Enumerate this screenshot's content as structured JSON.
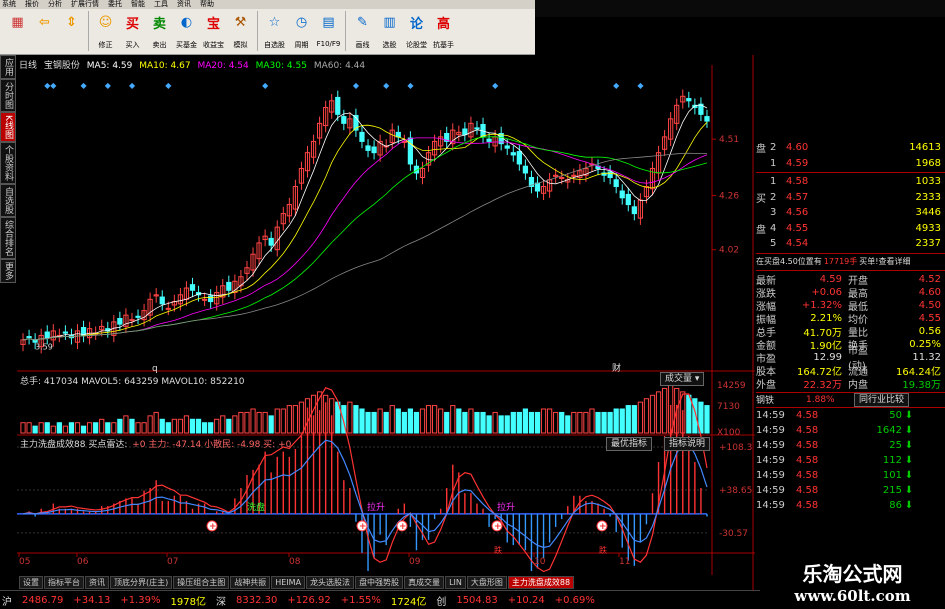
{
  "menu": [
    "系统",
    "报价",
    "分析",
    "扩展行情",
    "委托",
    "智能",
    "工具",
    "资讯",
    "帮助"
  ],
  "toolbar": [
    {
      "label": "",
      "icon": "grid-icon",
      "glyph": "▦",
      "color": "#c33"
    },
    {
      "label": "",
      "icon": "back-arrow-icon",
      "glyph": "⇦",
      "color": "#e90"
    },
    {
      "label": "",
      "icon": "up-down-icon",
      "glyph": "⇕",
      "color": "#e90"
    },
    {
      "label": "修正",
      "icon": "fix-icon",
      "glyph": "☺",
      "color": "#e90"
    },
    {
      "label": "买入",
      "icon": "buy-icon",
      "glyph": "买",
      "color": "#d00"
    },
    {
      "label": "卖出",
      "icon": "sell-icon",
      "glyph": "卖",
      "color": "#080"
    },
    {
      "label": "买基金",
      "icon": "fund-icon",
      "glyph": "◐",
      "color": "#06c"
    },
    {
      "label": "收益宝",
      "icon": "bao-icon",
      "glyph": "宝",
      "color": "#d00"
    },
    {
      "label": "模拟",
      "icon": "hammer-icon",
      "glyph": "⚒",
      "color": "#a50"
    },
    {
      "label": "自选股",
      "icon": "star-list-icon",
      "glyph": "☆",
      "color": "#06c"
    },
    {
      "label": "周期",
      "icon": "clock-icon",
      "glyph": "◷",
      "color": "#06c"
    },
    {
      "label": "F10/F9",
      "icon": "f10-icon",
      "glyph": "▤",
      "color": "#06c"
    },
    {
      "label": "画线",
      "icon": "pencil-icon",
      "glyph": "✎",
      "color": "#06c"
    },
    {
      "label": "选股",
      "icon": "select-stock-icon",
      "glyph": "▥",
      "color": "#06c"
    },
    {
      "label": "论股堂",
      "icon": "forum-icon",
      "glyph": "论",
      "color": "#06c"
    },
    {
      "label": "抗基手",
      "icon": "gao-icon",
      "glyph": "高",
      "color": "#d00"
    }
  ],
  "left_tabs": [
    {
      "label": "应用",
      "active": false
    },
    {
      "label": "分时图",
      "active": false
    },
    {
      "label": "K线图",
      "active": true
    },
    {
      "label": "个股资料",
      "active": false
    },
    {
      "label": "自选股",
      "active": false
    },
    {
      "label": "综合排名",
      "active": false
    },
    {
      "label": "更多",
      "active": false
    }
  ],
  "info": {
    "period": "日线",
    "stock": "宝钢股份",
    "ma5": "MA5: 4.59",
    "ma10": "MA10: 4.67",
    "ma20": "MA20: 4.54",
    "ma30": "MA30: 4.55",
    "ma60": "MA60: 4.44"
  },
  "price_axis": [
    "4.51",
    "4.26",
    "4.02"
  ],
  "price_low_label": "3.59",
  "marker_q": "q",
  "marker_cai": "财",
  "volume": {
    "line": "总手: 417034  MAVOL5: 643259  MAVOL10: 852210",
    "dropdown": "成交量",
    "axis": [
      "14259",
      "7130",
      "X100"
    ]
  },
  "indicator": {
    "line_a": "主力洗盘成效88  买点雷达:",
    "line_b": "+0  主力: -47.14  小散民: -4.98  买: +0",
    "btn_best": "最优指标",
    "btn_desc": "指标说明",
    "axis": [
      "+108.3",
      "+38.65",
      "-30.57"
    ],
    "tags": [
      "洗盘",
      "拉升",
      "拉升"
    ],
    "buy_glyph": "+",
    "dip_glyph": "跌"
  },
  "date_axis": [
    "05",
    "06",
    "07",
    "08",
    "09",
    "10",
    "11"
  ],
  "orderbook": {
    "sell_label": "盘",
    "buy_label_1": "买",
    "buy_label_2": "盘",
    "sell": [
      {
        "lv": "2",
        "price": "4.60",
        "vol": "14613"
      },
      {
        "lv": "1",
        "price": "4.59",
        "vol": "1968"
      }
    ],
    "buy": [
      {
        "lv": "1",
        "price": "4.58",
        "vol": "1033"
      },
      {
        "lv": "2",
        "price": "4.57",
        "vol": "2333"
      },
      {
        "lv": "3",
        "price": "4.56",
        "vol": "3446"
      },
      {
        "lv": "4",
        "price": "4.55",
        "vol": "4933"
      },
      {
        "lv": "5",
        "price": "4.54",
        "vol": "2337"
      }
    ]
  },
  "buy_pos": {
    "text": "在买盘4.50位置有",
    "qty": "17719手",
    "link": "买单!查看详细"
  },
  "stats": [
    {
      "k": "最新",
      "v": "4.59",
      "vc": "red",
      "k2": "开盘",
      "v2": "4.52",
      "v2c": "red"
    },
    {
      "k": "涨跌",
      "v": "+0.06",
      "vc": "red",
      "k2": "最高",
      "v2": "4.60",
      "v2c": "red"
    },
    {
      "k": "涨幅",
      "v": "+1.32%",
      "vc": "red",
      "k2": "最低",
      "v2": "4.50",
      "v2c": "red"
    },
    {
      "k": "振幅",
      "v": "2.21%",
      "vc": "yel",
      "k2": "均价",
      "v2": "4.55",
      "v2c": "red"
    },
    {
      "k": "总手",
      "v": "41.70万",
      "vc": "yel",
      "k2": "量比",
      "v2": "0.56",
      "v2c": "yel"
    },
    {
      "k": "金额",
      "v": "1.90亿",
      "vc": "yel",
      "k2": "换手",
      "v2": "0.25%",
      "v2c": "yel"
    },
    {
      "k": "市盈",
      "v": "12.99",
      "vc": "wht",
      "k2": "市盈(动)",
      "v2": "11.32",
      "v2c": "wht"
    },
    {
      "k": "股本",
      "v": "164.72亿",
      "vc": "yel",
      "k2": "流通",
      "v2": "164.24亿",
      "v2c": "yel"
    },
    {
      "k": "外盘",
      "v": "22.32万",
      "vc": "red",
      "k2": "内盘",
      "v2": "19.38万",
      "v2c": "grn"
    }
  ],
  "sector": {
    "name": "钢铁",
    "pct": "1.88%",
    "btn": "同行业比较"
  },
  "ticks": [
    {
      "t": "14:59",
      "p": "4.58",
      "q": "50",
      "dir": "down"
    },
    {
      "t": "14:59",
      "p": "4.58",
      "q": "1642",
      "dir": "down"
    },
    {
      "t": "14:59",
      "p": "4.58",
      "q": "25",
      "dir": "down"
    },
    {
      "t": "14:59",
      "p": "4.58",
      "q": "112",
      "dir": "down"
    },
    {
      "t": "14:59",
      "p": "4.58",
      "q": "101",
      "dir": "down"
    },
    {
      "t": "14:59",
      "p": "4.58",
      "q": "215",
      "dir": "down"
    },
    {
      "t": "14:59",
      "p": "4.58",
      "q": "86",
      "dir": "down"
    }
  ],
  "bottom_tabs": [
    "设置",
    "指标平台",
    "资讯",
    "顶底分界(庄主)",
    "操压组合主图",
    "战神共振",
    "HEIMA",
    "龙头选股法",
    "盘中强势股",
    "真成交量",
    "LIN",
    "大盘形图",
    "主力洗盘成效88"
  ],
  "bottom_active": 12,
  "status": {
    "mkt": "沪",
    "idx": "2486.79",
    "chg": "+34.13",
    "pct": "+1.39%",
    "amt": "1978亿",
    "amt_label": "深",
    "idx2": "8332.30",
    "chg2": "+126.92",
    "pct2": "+1.55%",
    "amt2": "1724亿",
    "ch_label": "创",
    "idx3": "1504.83",
    "chg3": "+10.24",
    "pct3": "+0.69%"
  },
  "watermark": {
    "title": "乐淘公式网",
    "url": "www.60lt.com"
  },
  "chart_data": {
    "type": "candlestick",
    "title": "宝钢股份 日线",
    "xlabel": "",
    "ylabel": "",
    "months": [
      "05",
      "06",
      "07",
      "08",
      "09",
      "10",
      "11"
    ],
    "ylim": [
      3.5,
      4.75
    ],
    "close": [
      3.62,
      3.63,
      3.61,
      3.64,
      3.63,
      3.66,
      3.64,
      3.65,
      3.63,
      3.66,
      3.64,
      3.67,
      3.65,
      3.68,
      3.66,
      3.7,
      3.69,
      3.73,
      3.71,
      3.72,
      3.75,
      3.8,
      3.82,
      3.78,
      3.76,
      3.79,
      3.82,
      3.85,
      3.84,
      3.82,
      3.8,
      3.79,
      3.83,
      3.86,
      3.84,
      3.88,
      3.9,
      3.94,
      4.0,
      4.05,
      4.08,
      4.04,
      4.12,
      4.18,
      4.22,
      4.3,
      4.38,
      4.45,
      4.5,
      4.58,
      4.65,
      4.68,
      4.62,
      4.58,
      4.6,
      4.55,
      4.5,
      4.46,
      4.45,
      4.5,
      4.48,
      4.55,
      4.52,
      4.5,
      4.4,
      4.36,
      4.38,
      4.45,
      4.5,
      4.52,
      4.5,
      4.55,
      4.54,
      4.53,
      4.58,
      4.56,
      4.52,
      4.5,
      4.52,
      4.49,
      4.47,
      4.44,
      4.4,
      4.36,
      4.3,
      4.28,
      4.3,
      4.33,
      4.35,
      4.34,
      4.33,
      4.35,
      4.37,
      4.38,
      4.4,
      4.38,
      4.35,
      4.34,
      4.3,
      4.25,
      4.22,
      4.18,
      4.24,
      4.3,
      4.38,
      4.45,
      4.52,
      4.6,
      4.66,
      4.7,
      4.68,
      4.65,
      4.62,
      4.59
    ],
    "volume": [
      3,
      3,
      2,
      3,
      3,
      2,
      3,
      2,
      3,
      3,
      2,
      3,
      3,
      4,
      3,
      3,
      4,
      5,
      4,
      3,
      3,
      5,
      6,
      4,
      3,
      4,
      4,
      5,
      4,
      4,
      3,
      3,
      4,
      5,
      4,
      5,
      6,
      6,
      7,
      6,
      6,
      5,
      7,
      7,
      8,
      8,
      9,
      10,
      11,
      12,
      11,
      10,
      9,
      8,
      9,
      8,
      7,
      6,
      6,
      7,
      6,
      8,
      7,
      6,
      7,
      6,
      7,
      8,
      8,
      7,
      6,
      8,
      7,
      6,
      7,
      6,
      6,
      5,
      6,
      5,
      5,
      6,
      6,
      7,
      6,
      6,
      7,
      7,
      6,
      6,
      5,
      6,
      6,
      6,
      7,
      6,
      6,
      6,
      7,
      7,
      8,
      8,
      9,
      10,
      11,
      12,
      13,
      14,
      13,
      12,
      11,
      10,
      9,
      8
    ],
    "indicator_axis": [
      108.3,
      38.65,
      -30.57
    ]
  }
}
